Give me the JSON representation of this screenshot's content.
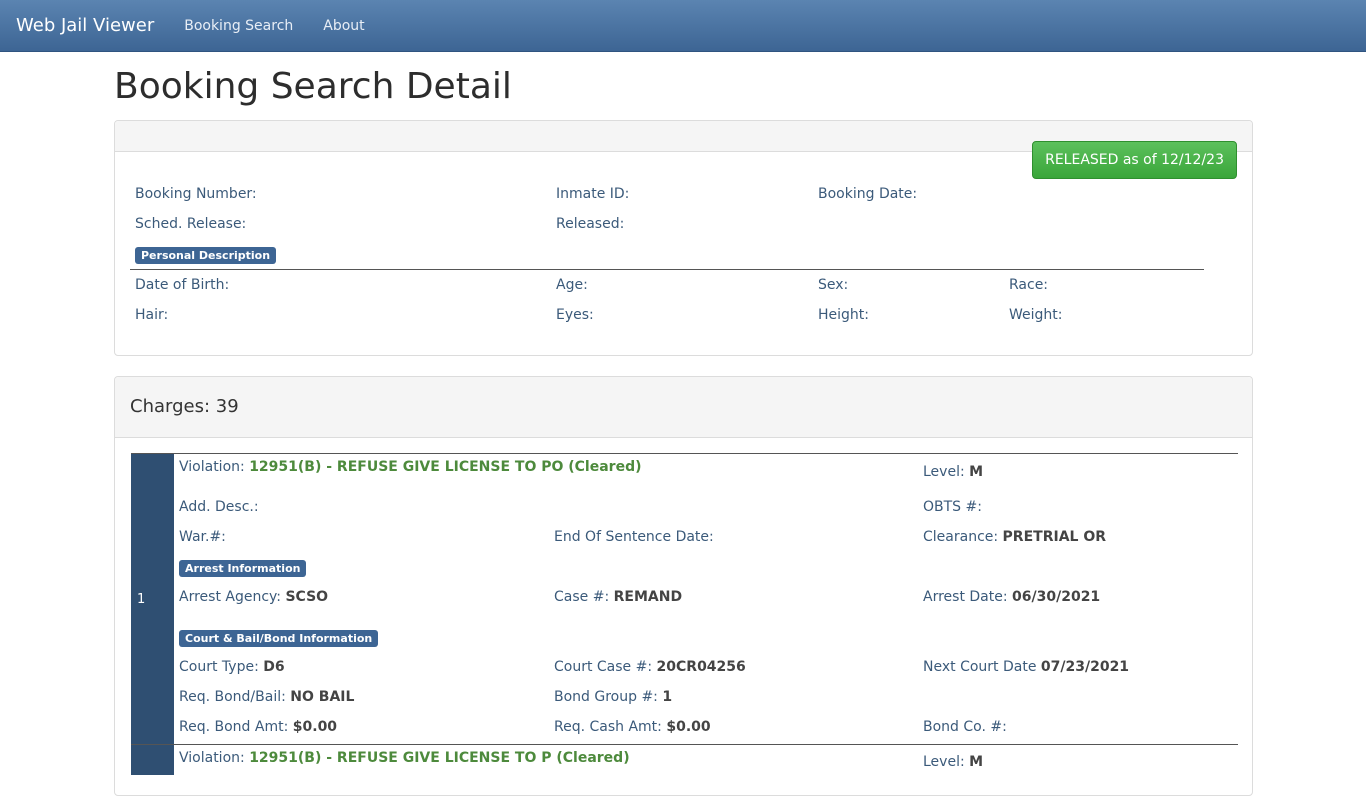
{
  "nav": {
    "brand": "Web Jail Viewer",
    "links": [
      "Booking Search",
      "About"
    ]
  },
  "page_title": "Booking Search Detail",
  "status": "RELEASED as of 12/12/23",
  "booking": {
    "booking_number_label": "Booking Number:",
    "inmate_id_label": "Inmate ID:",
    "booking_date_label": "Booking Date:",
    "sched_release_label": "Sched. Release:",
    "released_label": "Released:"
  },
  "personal": {
    "section_label": "Personal Description",
    "dob_label": "Date of Birth:",
    "age_label": "Age:",
    "sex_label": "Sex:",
    "race_label": "Race:",
    "hair_label": "Hair:",
    "eyes_label": "Eyes:",
    "height_label": "Height:",
    "weight_label": "Weight:"
  },
  "charges_header": "Charges: 39",
  "charge1": {
    "num": "1",
    "violation_label": "Violation:",
    "violation": "12951(B) - REFUSE GIVE LICENSE TO PO (Cleared)",
    "level_label": "Level:",
    "level": "M",
    "add_desc_label": "Add. Desc.:",
    "obts_label": "OBTS #:",
    "war_label": "War.#:",
    "eos_label": "End Of Sentence Date:",
    "clearance_label": "Clearance:",
    "clearance": "PRETRIAL OR",
    "arrest_section": "Arrest Information",
    "agency_label": "Arrest Agency:",
    "agency": "SCSO",
    "case_label": "Case #:",
    "case": "REMAND",
    "arrest_date_label": "Arrest Date:",
    "arrest_date": "06/30/2021",
    "court_section": "Court & Bail/Bond Information",
    "court_type_label": "Court Type:",
    "court_type": "D6",
    "court_case_label": "Court Case #:",
    "court_case": "20CR04256",
    "next_court_label": "Next Court Date",
    "next_court": "07/23/2021",
    "req_bond_label": "Req. Bond/Bail:",
    "req_bond": "NO BAIL",
    "bond_group_label": "Bond Group #:",
    "bond_group": "1",
    "bond_amt_label": "Req. Bond Amt:",
    "bond_amt": "$0.00",
    "cash_amt_label": "Req. Cash Amt:",
    "cash_amt": "$0.00",
    "bond_co_label": "Bond Co. #:"
  },
  "charge2": {
    "violation_label": "Violation:",
    "violation": "12951(B) - REFUSE GIVE LICENSE TO P (Cleared)",
    "level_label": "Level:",
    "level": "M"
  }
}
